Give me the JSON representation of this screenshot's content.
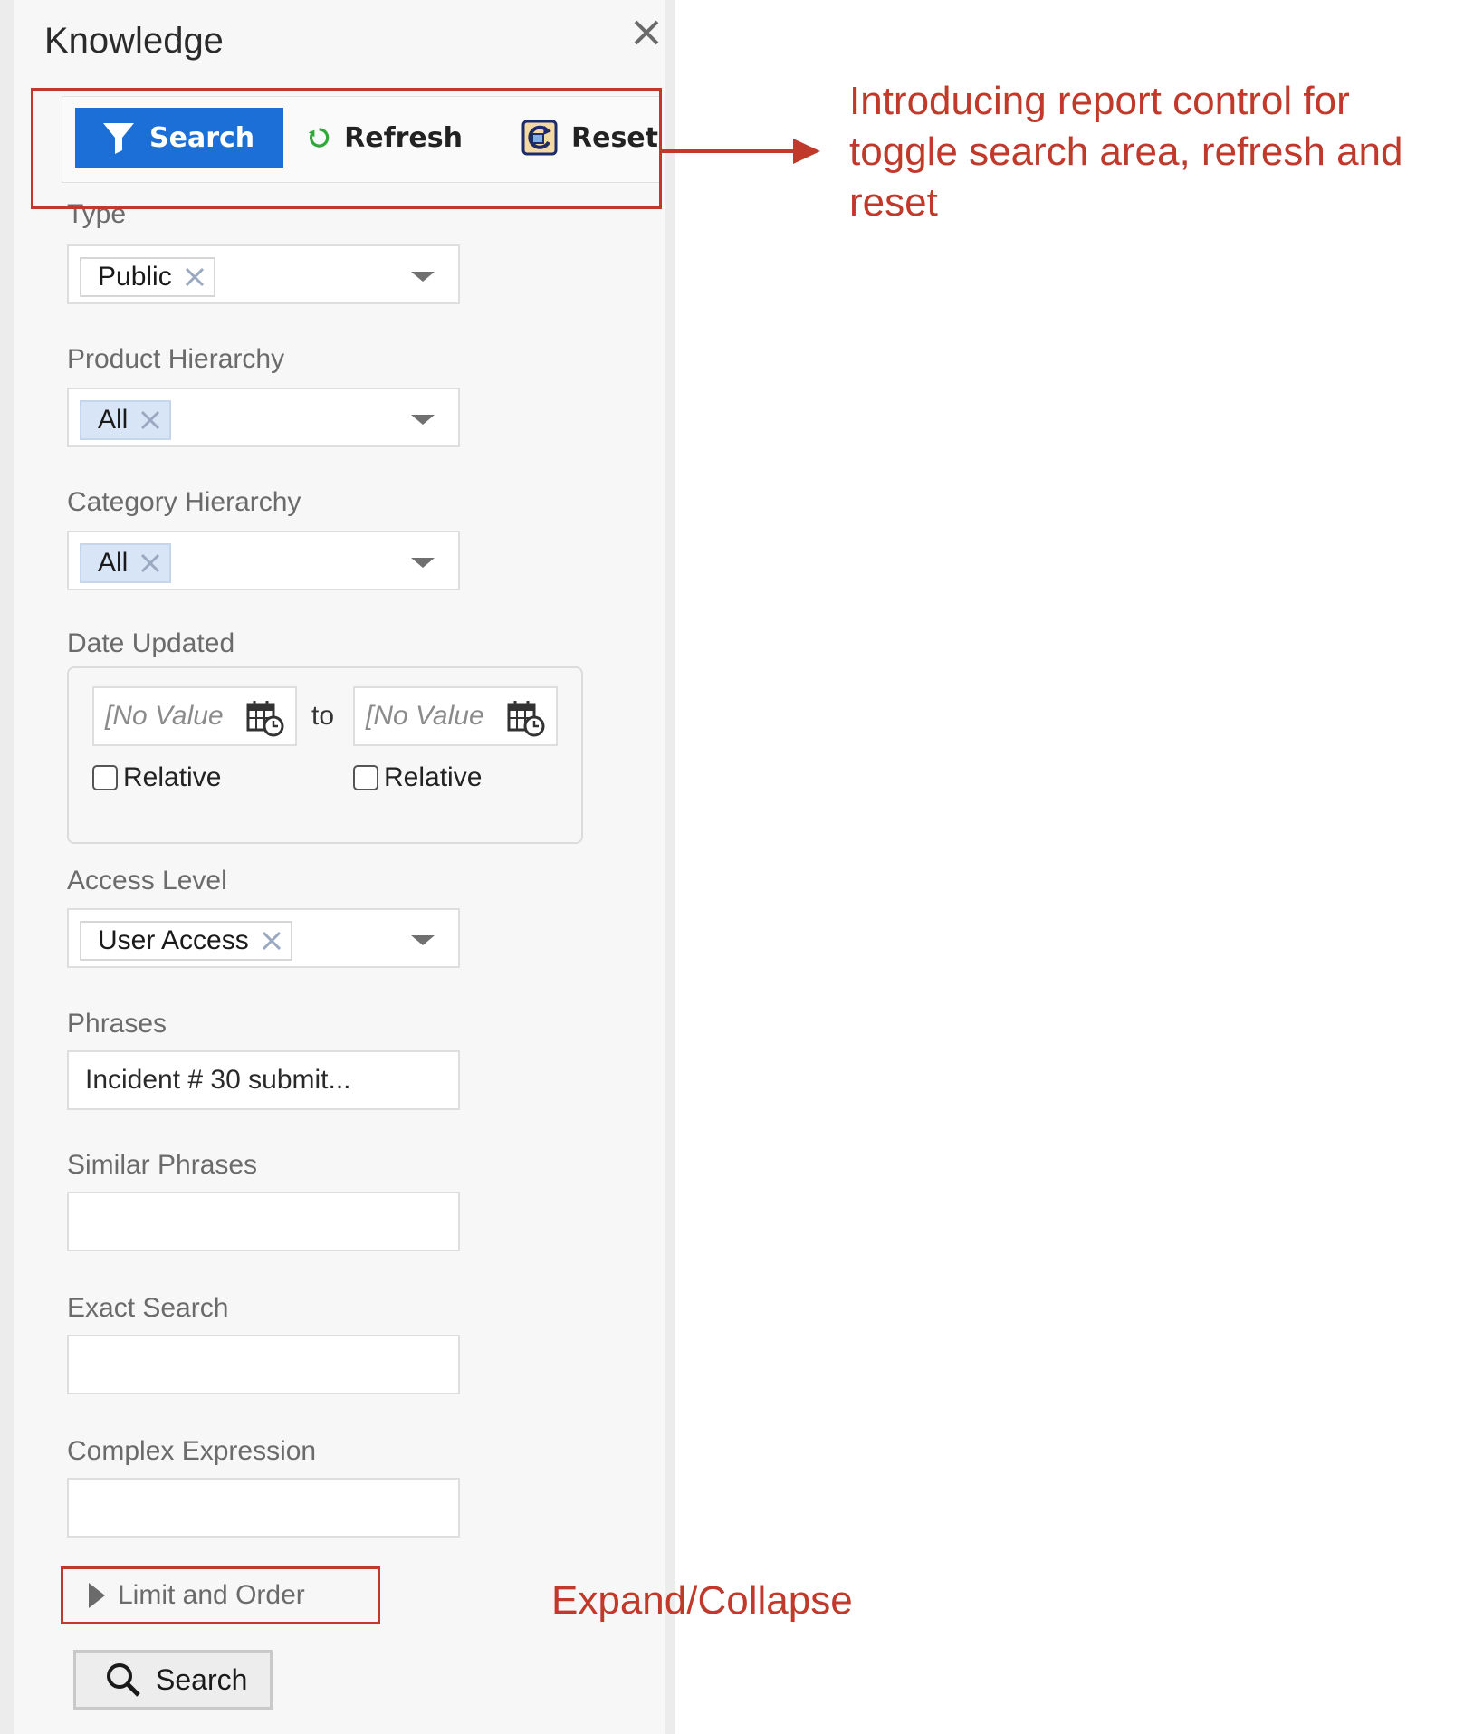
{
  "panel": {
    "title": "Knowledge"
  },
  "toolbar": {
    "search_label": "Search",
    "refresh_label": "Refresh",
    "reset_label": "Reset"
  },
  "fields": {
    "type": {
      "label": "Type",
      "chip": "Public"
    },
    "product_hierarchy": {
      "label": "Product Hierarchy",
      "chip": "All"
    },
    "category_hierarchy": {
      "label": "Category Hierarchy",
      "chip": "All"
    },
    "date_updated": {
      "label": "Date Updated",
      "from_placeholder": "[No Value",
      "to_text": "to",
      "to_placeholder": "[No Value",
      "relative_from": "Relative",
      "relative_to": "Relative"
    },
    "access_level": {
      "label": "Access Level",
      "chip": "User Access"
    },
    "phrases": {
      "label": "Phrases",
      "value": "Incident # 30 submit..."
    },
    "similar_phrases": {
      "label": "Similar Phrases",
      "value": ""
    },
    "exact_search": {
      "label": "Exact Search",
      "value": ""
    },
    "complex_expression": {
      "label": "Complex Expression",
      "value": ""
    }
  },
  "limit_order": {
    "label": "Limit and Order"
  },
  "search_button": {
    "label": "Search"
  },
  "annotations": {
    "toolbar_note_line1": "Introducing report control for",
    "toolbar_note_line2": "toggle search area, refresh and",
    "toolbar_note_line3": "reset",
    "expand_note": "Expand/Collapse"
  },
  "colors": {
    "accent": "#1b6fd6",
    "annotation": "#c0392b",
    "chip_selected": "#d7e5f7",
    "refresh_icon": "#2eaa3a"
  },
  "icons": {
    "close": "close-icon",
    "filter": "filter-icon",
    "refresh": "refresh-icon",
    "reset": "reset-icon",
    "calendar": "calendar-icon",
    "magnifier": "search-icon"
  }
}
